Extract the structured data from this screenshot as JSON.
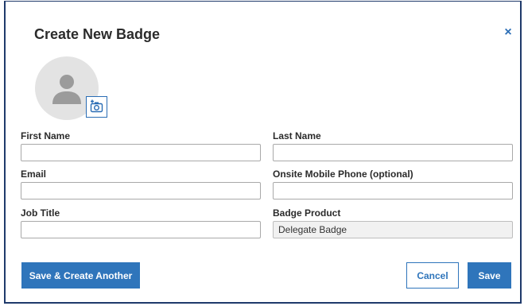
{
  "dialog": {
    "title": "Create New Badge",
    "close_label": "×"
  },
  "avatar": {
    "icon": "user-silhouette-icon",
    "upload_icon": "camera-add-icon"
  },
  "form": {
    "first_name": {
      "label": "First Name",
      "value": ""
    },
    "last_name": {
      "label": "Last Name",
      "value": ""
    },
    "email": {
      "label": "Email",
      "value": ""
    },
    "phone": {
      "label": "Onsite Mobile Phone (optional)",
      "value": ""
    },
    "job_title": {
      "label": "Job Title",
      "value": ""
    },
    "badge_product": {
      "label": "Badge Product",
      "value": "Delegate Badge"
    }
  },
  "buttons": {
    "save_another": "Save & Create Another",
    "cancel": "Cancel",
    "save": "Save"
  },
  "colors": {
    "accent": "#2f75bb",
    "frame_border": "#1f3a6b",
    "avatar_bg": "#e3e3e3"
  }
}
